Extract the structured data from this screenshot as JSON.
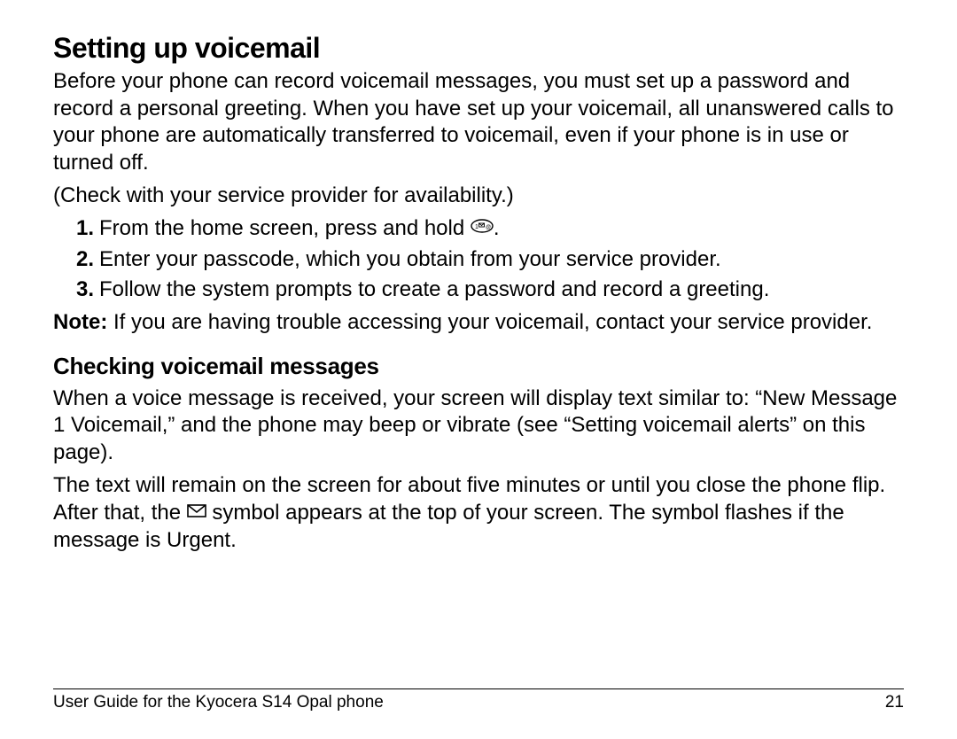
{
  "heading1": "Setting up voicemail",
  "para1": "Before your phone can record voicemail messages, you must set up a password and record a personal greeting. When you have set up your voicemail, all unanswered calls to your phone are automatically transferred to voicemail, even if your phone is in use or turned off.",
  "para2": "(Check with your service provider for availability.)",
  "steps": {
    "num1": "1.",
    "text1_before": "From the home screen, press and hold ",
    "text1_after": ".",
    "num2": "2.",
    "text2": "Enter your passcode, which you obtain from your service provider.",
    "num3": "3.",
    "text3": "Follow the system prompts to create a password and record a greeting."
  },
  "note_label": "Note:",
  "note_text": " If you are having trouble accessing your voicemail, contact your service provider.",
  "heading2": "Checking voicemail messages",
  "para3": "When a voice message is received, your screen will display text similar to: “New Message 1 Voicemail,” and the phone may beep or vibrate (see “Setting voicemail alerts” on this page).",
  "para4_before": "The text will remain on the screen for about five minutes or until you close the phone flip. After that, the ",
  "para4_after": " symbol appears at the top of your screen. The symbol flashes if the message is Urgent.",
  "footer_left": "User Guide for the Kyocera S14 Opal phone",
  "footer_right": "21"
}
